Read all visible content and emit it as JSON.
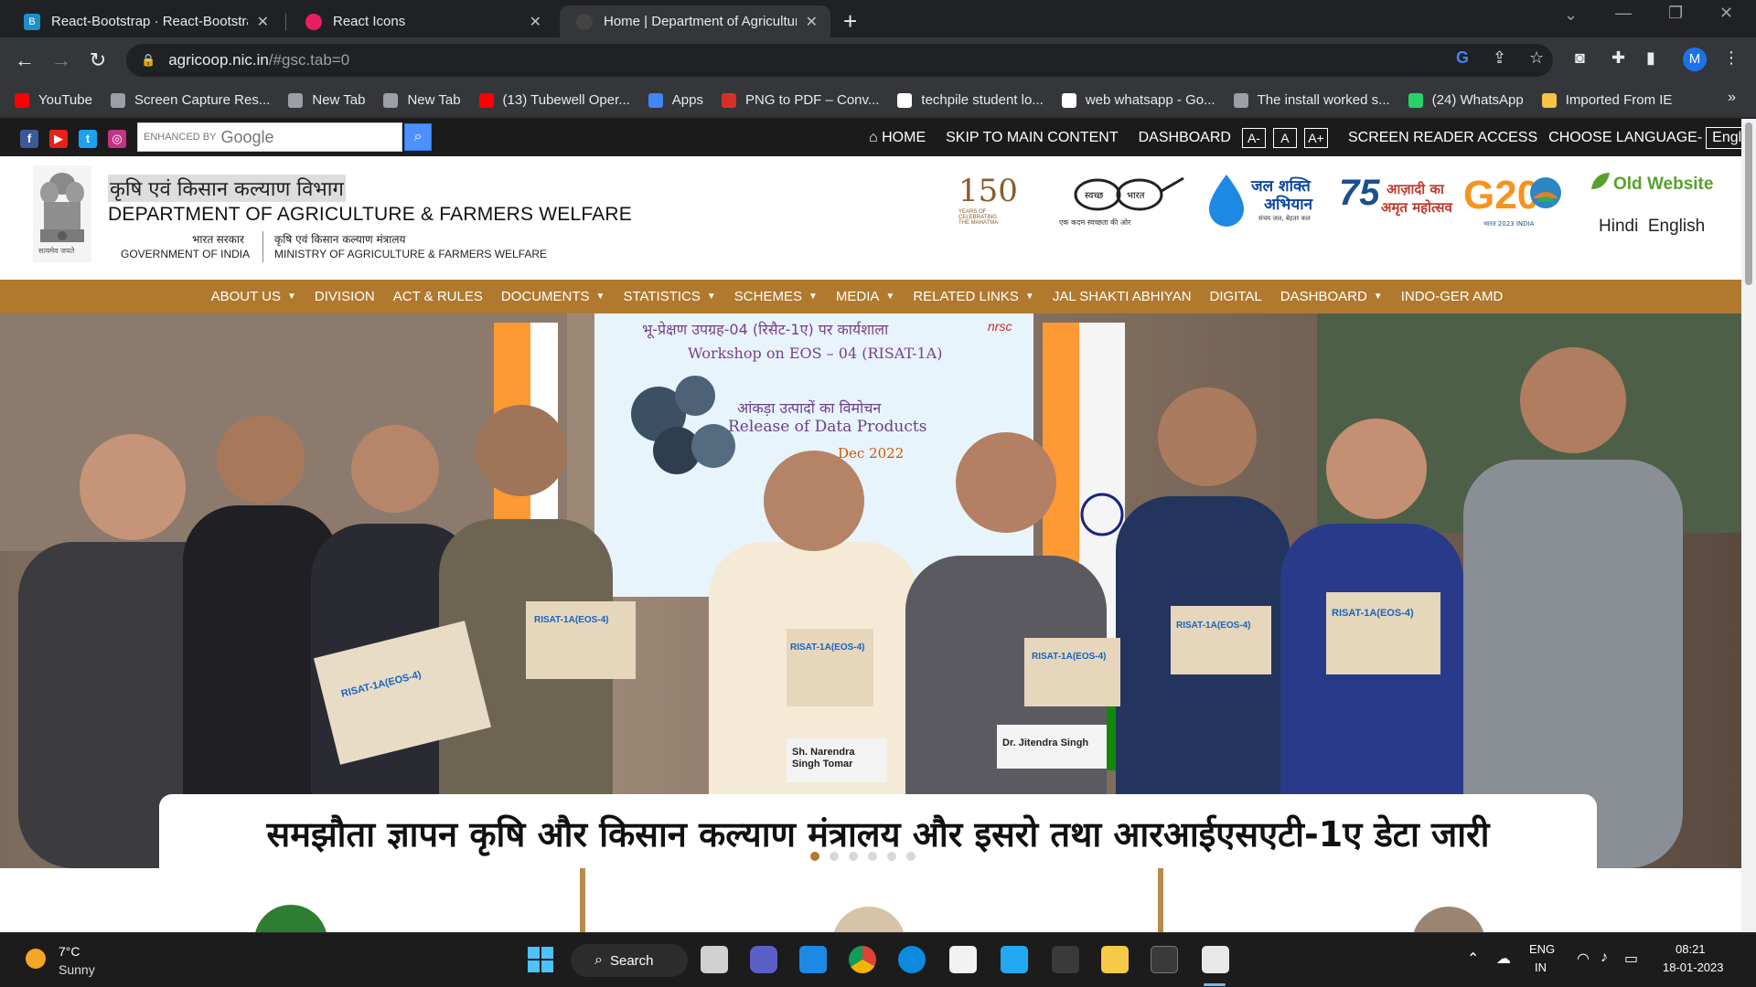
{
  "browser": {
    "tabs": [
      {
        "title": "React-Bootstrap · React-Bootstrap",
        "favicon_color": "#1e8fc9",
        "active": false
      },
      {
        "title": "React Icons",
        "favicon_color": "#e91e63",
        "active": false
      },
      {
        "title": "Home | Department of Agriculture",
        "favicon_color": "#444444",
        "active": true
      }
    ],
    "url_host": "agricoop.nic.in",
    "url_path": "/#gsc.tab=0",
    "profile_initial": "M",
    "bookmarks": [
      {
        "label": "YouTube",
        "color": "#ff0000"
      },
      {
        "label": "Screen Capture Res...",
        "color": "#9aa0a6"
      },
      {
        "label": "New Tab",
        "color": "#9aa0a6"
      },
      {
        "label": "New Tab",
        "color": "#9aa0a6"
      },
      {
        "label": "(13) Tubewell Oper...",
        "color": "#ff0000"
      },
      {
        "label": "Apps",
        "color": "#4285f4"
      },
      {
        "label": "PNG to PDF – Conv...",
        "color": "#d93025"
      },
      {
        "label": "techpile student lo...",
        "color": "#ffffff"
      },
      {
        "label": "web whatsapp - Go...",
        "color": "#ffffff"
      },
      {
        "label": "The install worked s...",
        "color": "#9aa0a6"
      },
      {
        "label": "(24) WhatsApp",
        "color": "#25d366"
      },
      {
        "label": "Imported From IE",
        "color": "#f6c344"
      }
    ]
  },
  "site": {
    "search_label_enhanced": "ENHANCED BY",
    "search_label_google": "Google",
    "top_links": {
      "home": "HOME",
      "skip": "SKIP TO MAIN CONTENT",
      "dashboard": "DASHBOARD",
      "font_small": "A-",
      "font_normal": "A",
      "font_large": "A+",
      "screen_reader": "SCREEN READER ACCESS",
      "choose_language": "CHOOSE LANGUAGE-",
      "language_value": "English"
    },
    "header": {
      "title_hindi": "कृषि एवं किसान कल्याण विभाग",
      "title_english": "DEPARTMENT OF AGRICULTURE & FARMERS WELFARE",
      "gov_hindi": "भारत सरकार",
      "gov_english": "GOVERNMENT OF INDIA",
      "ministry_hindi": "कृषि एवं किसान कल्याण मंत्रालय",
      "ministry_english": "MINISTRY OF AGRICULTURE & FARMERS WELFARE",
      "emblem_motto": "सत्यमेव जयते",
      "old_website": "Old Website",
      "lang_hindi": "Hindi",
      "lang_english": "English"
    },
    "logos": {
      "gandhi_150_num": "150",
      "gandhi_150_line1": "YEARS OF",
      "gandhi_150_line2": "CELEBRATING",
      "gandhi_150_line3": "THE MAHATMA",
      "swachh_left": "स्वच्छ",
      "swachh_right": "भारत",
      "swachh_tagline": "एक कदम स्वच्छता की ओर",
      "jal_line1": "जल शक्ति",
      "jal_line2": "अभियान",
      "jal_tagline": "संचय जल, बेहतर कल",
      "azadi_num": "75",
      "azadi_line1": "आज़ादी का",
      "azadi_line2": "अमृत महोत्सव",
      "g20": "G20",
      "g20_sub": "भारत 2023 INDIA"
    },
    "nav": [
      {
        "label": "ABOUT US",
        "dropdown": true
      },
      {
        "label": "DIVISION",
        "dropdown": false
      },
      {
        "label": "ACT & RULES",
        "dropdown": false
      },
      {
        "label": "DOCUMENTS",
        "dropdown": true
      },
      {
        "label": "STATISTICS",
        "dropdown": true
      },
      {
        "label": "SCHEMES",
        "dropdown": true
      },
      {
        "label": "MEDIA",
        "dropdown": true
      },
      {
        "label": "RELATED LINKS",
        "dropdown": true
      },
      {
        "label": "JAL SHAKTI ABHIYAN",
        "dropdown": false
      },
      {
        "label": "DIGITAL",
        "dropdown": false
      },
      {
        "label": "DASHBOARD",
        "dropdown": true
      },
      {
        "label": "INDO-GER AMD",
        "dropdown": false
      }
    ],
    "hero": {
      "banner_hindi": "भू-प्रेक्षण उपग्रह-04 (रिसैट-1ए) पर कार्यशाला",
      "banner_english": "Workshop on EOS – 04 (RISAT-1A)",
      "banner_org": "nrsc",
      "banner_release_hindi": "आंकड़ा उत्पादों का विमोचन",
      "banner_release_english": "Release of Data Products",
      "banner_date": "Dec 2022",
      "booklet_label": "RISAT-1A(EOS-4)",
      "nameplate_1": "Sh. Narendra Singh Tomar",
      "nameplate_2": "Dr. Jitendra Singh",
      "caption": "समझौता ज्ञापन कृषि और किसान कल्याण मंत्रालय और इसरो तथा आरआईएसएटी-1ए डेटा जारी",
      "slide_count": 6,
      "active_slide": 0
    }
  },
  "taskbar": {
    "temperature": "7°C",
    "condition": "Sunny",
    "search_label": "Search",
    "lang_top": "ENG",
    "lang_bottom": "IN",
    "time": "08:21",
    "date": "18-01-2023"
  }
}
